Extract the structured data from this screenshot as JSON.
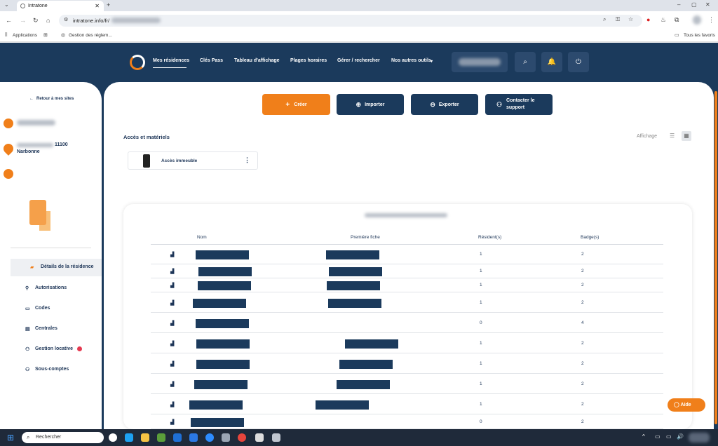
{
  "browser": {
    "tab_title": "Intratone",
    "url": "intratone.info/fr/",
    "bookmarks": [
      "Applications",
      "Gestion des réglem...",
      "Tous les favoris"
    ]
  },
  "header": {
    "nav": [
      "Mes résidences",
      "Clés Pass",
      "Tableau d'affichage",
      "Plages horaires",
      "Gérer / rechercher",
      "Nos autres outils"
    ],
    "active_nav": "Mes résidences"
  },
  "sidebar": {
    "back_label": "Retour à mes sites",
    "address_line1": "11100",
    "address_line2": "Narbonne",
    "items": [
      {
        "label": "Détails de la résidence",
        "icon": "building-icon",
        "active": true
      },
      {
        "label": "Autorisations",
        "icon": "key-icon"
      },
      {
        "label": "Codes",
        "icon": "keypad-icon"
      },
      {
        "label": "Centrales",
        "icon": "grid-icon"
      },
      {
        "label": "Gestion locative",
        "icon": "people-icon"
      },
      {
        "label": "Sous-comptes",
        "icon": "users-icon"
      }
    ]
  },
  "actions": {
    "create": "Créer",
    "import": "Importer",
    "export": "Exporter",
    "contact": "Contacter le support"
  },
  "section": {
    "title": "Accès et matériels",
    "display_label": "Affichage",
    "access_item": "Accès immeuble"
  },
  "table": {
    "headers": [
      "Nom",
      "Première fiche",
      "Résident(s)",
      "Badge(s)"
    ],
    "rows": [
      {
        "residents": "1",
        "badges": "2"
      },
      {
        "residents": "1",
        "badges": "2"
      },
      {
        "residents": "1",
        "badges": "2"
      },
      {
        "residents": "1",
        "badges": "2"
      },
      {
        "residents": "0",
        "badges": "4"
      },
      {
        "residents": "1",
        "badges": "2"
      },
      {
        "residents": "1",
        "badges": "2"
      },
      {
        "residents": "1",
        "badges": "2"
      },
      {
        "residents": "1",
        "badges": "2"
      },
      {
        "residents": "0",
        "badges": "2"
      }
    ]
  },
  "help_button": "Aide",
  "taskbar": {
    "search_placeholder": "Rechercher"
  },
  "colors": {
    "navy": "#1b3a5c",
    "orange": "#f07f1a",
    "white": "#ffffff"
  }
}
